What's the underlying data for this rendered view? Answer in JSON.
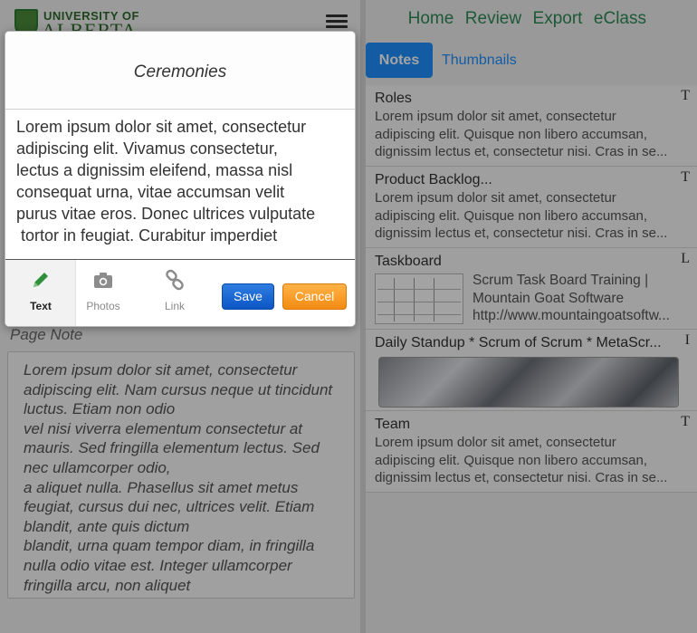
{
  "logo": {
    "line1": "UNIVERSITY OF",
    "line2": "ALBERTA"
  },
  "nav": {
    "items": [
      "Home",
      "Review",
      "Export",
      "eClass"
    ]
  },
  "tabs": {
    "notes": "Notes",
    "thumbnails": "Thumbnails"
  },
  "page_note": {
    "label": "Page Note",
    "lines": [
      "Lorem ipsum dolor sit amet, consectetur",
      "adipiscing elit. Nam cursus neque ut tincidunt",
      "luctus. Etiam non odio",
      "vel nisi viverra elementum consectetur at",
      "mauris. Sed fringilla elementum lectus. Sed",
      "nec ullamcorper odio,",
      "a aliquet nulla. Phasellus sit amet metus",
      "feugiat, cursus dui nec, ultrices velit. Etiam",
      "blandit, ante quis dictum",
      "blandit, urna quam tempor diam, in fringilla",
      "nulla odio vitae est. Integer ullamcorper",
      "fringilla arcu, non aliquet"
    ]
  },
  "notes": [
    {
      "title": "Roles",
      "type_glyph": "T",
      "lines": [
        "Lorem ipsum dolor sit amet, consectetur",
        "adipiscing elit. Quisque non libero accumsan,",
        "dignissim lectus et, consectetur nisi. Cras in se..."
      ]
    },
    {
      "title": "Product Backlog...",
      "type_glyph": "T",
      "lines": [
        "Lorem ipsum dolor sit amet, consectetur",
        "adipiscing elit. Quisque non libero accumsan,",
        "dignissim lectus et, consectetur nisi. Cras in se..."
      ]
    },
    {
      "title": "Taskboard",
      "type_glyph": "L",
      "lines": [
        "Scrum Task Board Training  |",
        "Mountain Goat Software",
        "http://www.mountaingoatsoftw..."
      ]
    },
    {
      "title": "Daily Standup * Scrum of Scrum * MetaScr...",
      "type_glyph": "I"
    },
    {
      "title": "Team",
      "type_glyph": "T",
      "lines": [
        "Lorem ipsum dolor sit amet, consectetur",
        "adipiscing elit. Quisque non libero accumsan,",
        "dignissim lectus et, consectetur nisi. Cras in se..."
      ]
    }
  ],
  "modal": {
    "title": "Ceremonies",
    "text_lines": [
      "Lorem ipsum dolor sit amet, consectetur",
      "adipiscing elit. Vivamus consectetur,",
      "lectus a dignissim eleifend, massa nisl",
      "consequat urna, vitae accumsan velit",
      "purus vitae eros. Donec ultrices vulputate",
      " tortor in feugiat. Curabitur imperdiet"
    ],
    "kinds": [
      "Text",
      "Photos",
      "Link"
    ],
    "save_label": "Save",
    "cancel_label": "Cancel"
  }
}
